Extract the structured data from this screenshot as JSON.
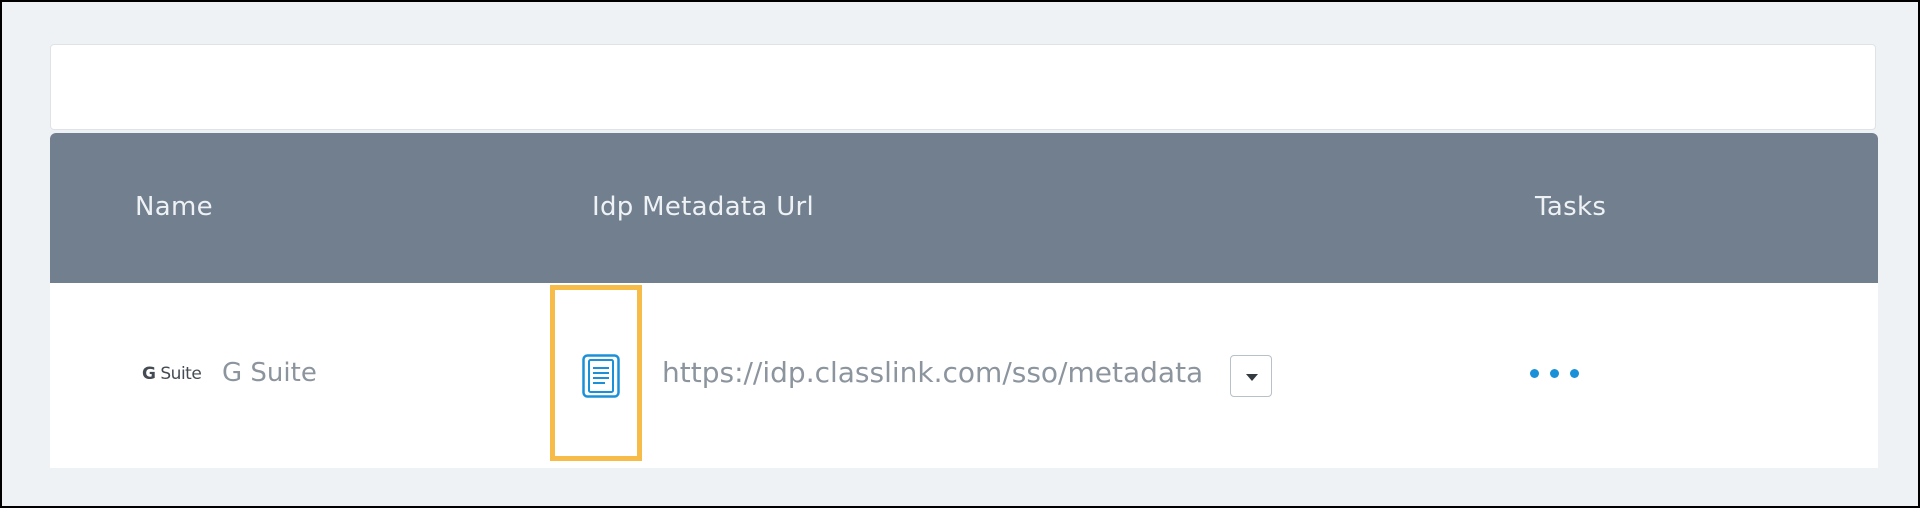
{
  "table": {
    "headers": {
      "name": "Name",
      "idp_metadata_url": "Idp Metadata Url",
      "tasks": "Tasks"
    },
    "rows": [
      {
        "logo_text_g": "G",
        "logo_text_suite": "Suite",
        "name": "G Suite",
        "metadata_icon": "document-icon",
        "idp_metadata_url": "https://idp.classlink.com/sso/metadata",
        "dropdown_icon": "caret-down-icon",
        "tasks_icon": "more-dots-icon"
      }
    ]
  },
  "colors": {
    "header_bg": "#717f8f",
    "page_bg": "#eef2f5",
    "highlight": "#f7bb48",
    "accent": "#1a90d9"
  }
}
